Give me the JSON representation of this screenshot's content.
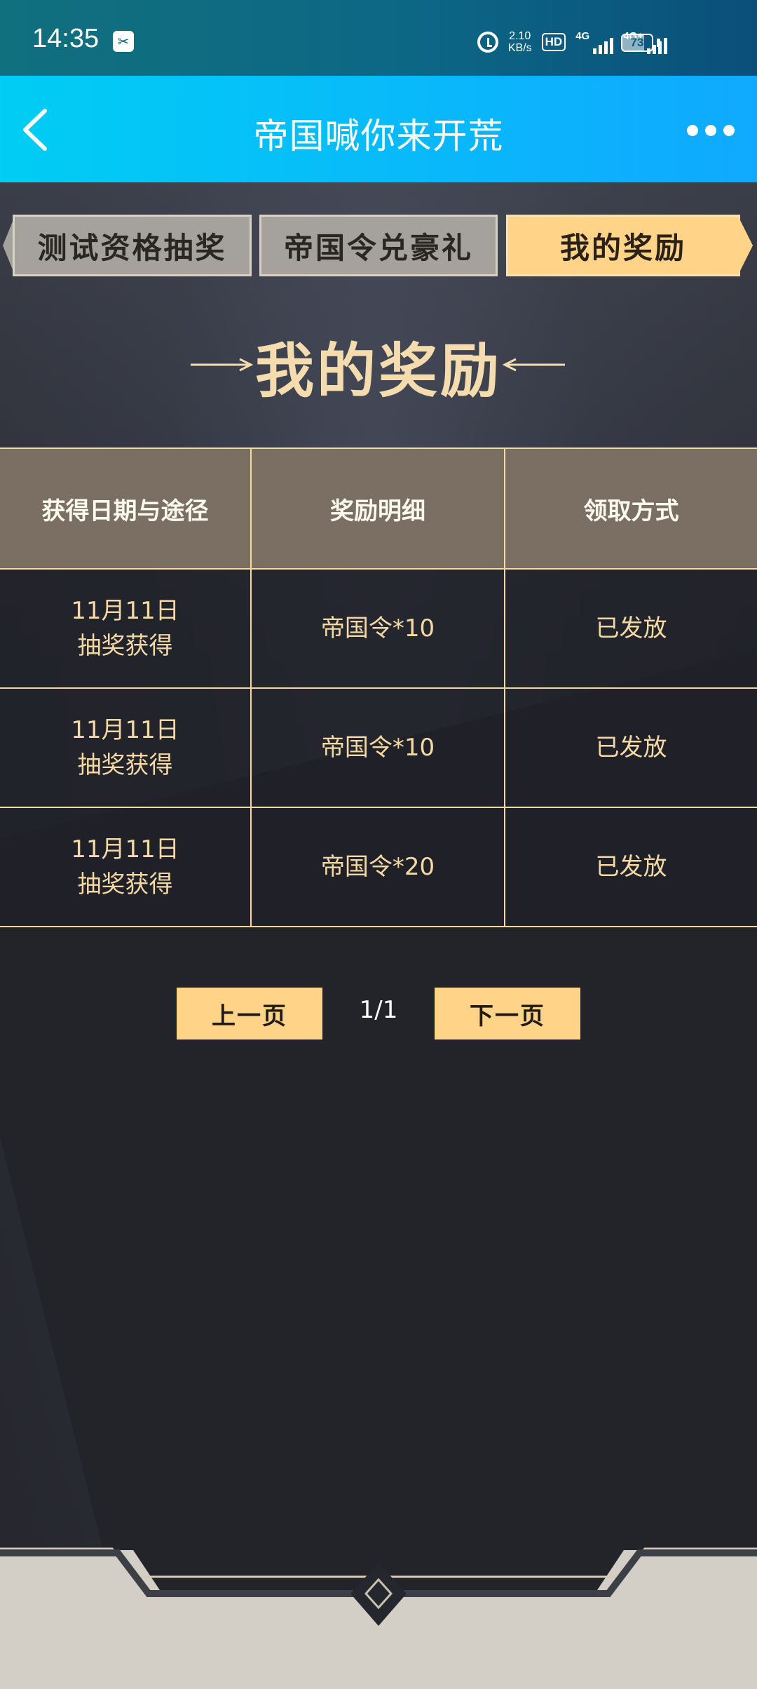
{
  "status_bar": {
    "time": "14:35",
    "app_icon": "app-notification-icon",
    "net_speed_value": "2.10",
    "net_speed_unit": "KB/s",
    "hd_label": "HD",
    "sim1_label": "4G",
    "sim2_label": "4G+",
    "battery_level": "73"
  },
  "header": {
    "title": "帝国喊你来开荒",
    "back_icon": "chevron-left-icon",
    "more_icon": "more-dots-icon"
  },
  "tabs": [
    {
      "label": "测试资格抽奖",
      "active": false
    },
    {
      "label": "帝国令兑豪礼",
      "active": false
    },
    {
      "label": "我的奖励",
      "active": true
    }
  ],
  "section": {
    "title": "我的奖励"
  },
  "table": {
    "headers": [
      "获得日期与途径",
      "奖励明细",
      "领取方式"
    ],
    "rows": [
      {
        "date": "11月11日",
        "source": "抽奖获得",
        "detail": "帝国令*10",
        "status": "已发放"
      },
      {
        "date": "11月11日",
        "source": "抽奖获得",
        "detail": "帝国令*10",
        "status": "已发放"
      },
      {
        "date": "11月11日",
        "source": "抽奖获得",
        "detail": "帝国令*20",
        "status": "已发放"
      }
    ]
  },
  "pagination": {
    "prev_label": "上一页",
    "indicator": "1/1",
    "next_label": "下一页"
  },
  "colors": {
    "accent_gold": "#ffd488",
    "title_bar": "#10a9ff",
    "table_border": "#f5d9a0"
  }
}
